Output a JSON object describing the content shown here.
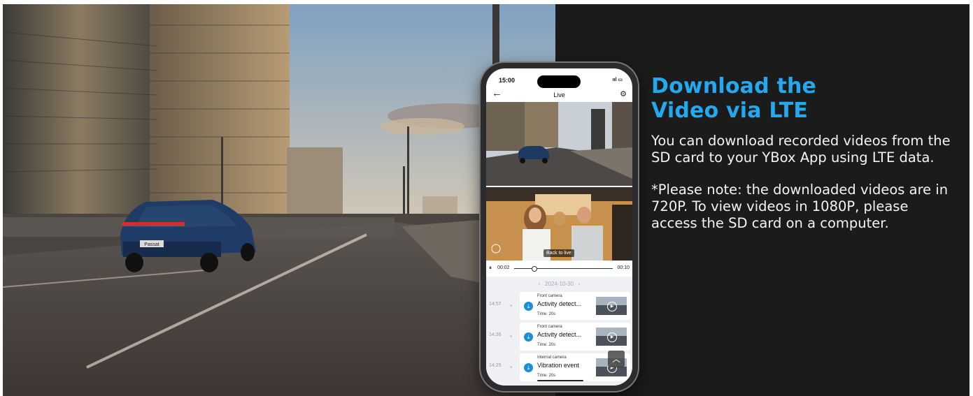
{
  "headline": {
    "line1": "Download the",
    "line2": "Video via LTE"
  },
  "description": "You can download recorded videos from the SD card to your YBox App using LTE data.",
  "note": "*Please note: the downloaded videos are in 720P. To view videos in 1080P, please access the SD card on a computer.",
  "car_plate": "Passat",
  "phone": {
    "status_time": "15:00",
    "status_icons": "ııl ▭",
    "nav_title": "Live",
    "back_to_live": "Back to live",
    "playback_start": "00:02",
    "playback_end": "00:10",
    "playback_fraction": 0.2,
    "date": "2024-10-30",
    "events": [
      {
        "time": "14:57",
        "camera": "Front camera",
        "title": "Activity detect...",
        "duration": "Time: 20s"
      },
      {
        "time": "14:36",
        "camera": "Front camera",
        "title": "Activity detect...",
        "duration": "Time: 20s"
      },
      {
        "time": "14:25",
        "camera": "Internal camera",
        "title": "Vibration event",
        "duration": "Time: 20s"
      }
    ]
  },
  "colors": {
    "accent": "#22a9f0",
    "panel_bg": "#1b1b1b"
  }
}
